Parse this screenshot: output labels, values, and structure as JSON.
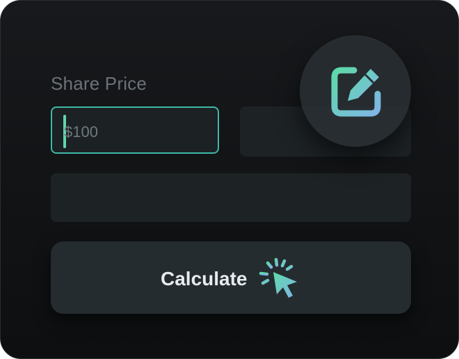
{
  "form": {
    "share_price_label": "Share Price",
    "share_price_value": "$100"
  },
  "actions": {
    "calculate_label": "Calculate"
  },
  "icons": {
    "edit": "edit-pencil-square-icon",
    "click": "click-cursor-icon"
  },
  "colors": {
    "accent_from": "#5ed9a8",
    "accent_to": "#7fb6e6",
    "focus_border": "#3fb8a6"
  }
}
